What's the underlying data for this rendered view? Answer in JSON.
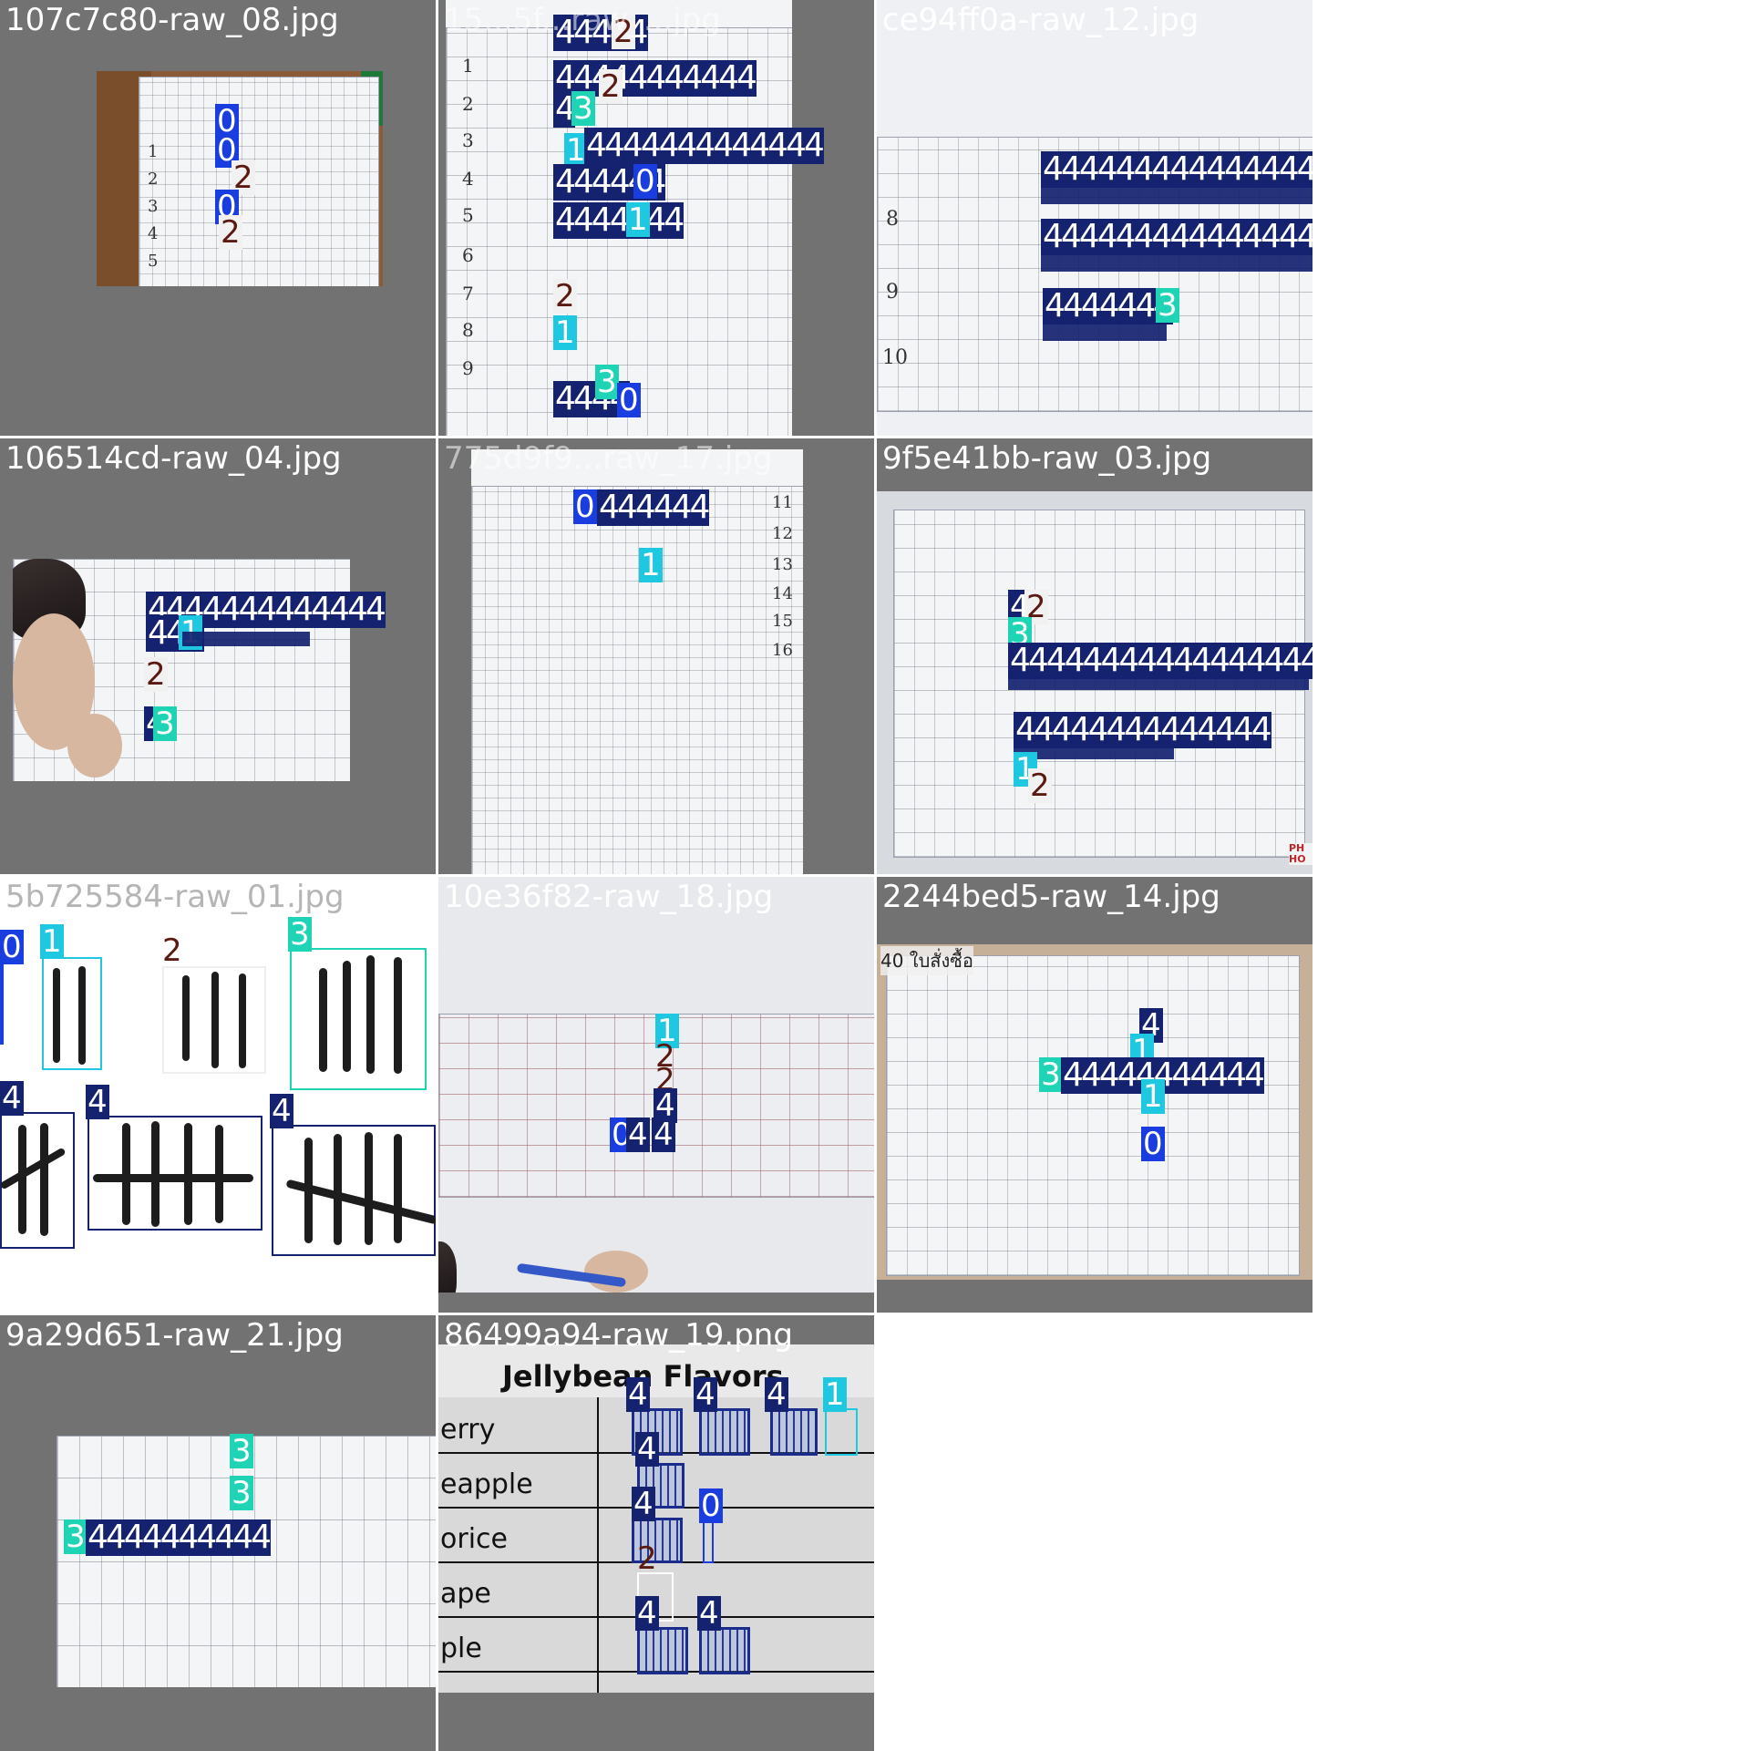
{
  "mosaic": {
    "tiles": [
      {
        "filename": "107c7c80-raw_08.jpg"
      },
      {
        "filename": "15...5f...raw_...jpg"
      },
      {
        "filename": "ce94ff0a-raw_12.jpg"
      },
      {
        "filename": "106514cd-raw_04.jpg"
      },
      {
        "filename": "775d9f9...raw_17.jpg"
      },
      {
        "filename": "9f5e41bb-raw_03.jpg"
      },
      {
        "filename": "5b725584-raw_01.jpg"
      },
      {
        "filename": "10e36f82-raw_18.jpg"
      },
      {
        "filename": "2244bed5-raw_14.jpg"
      },
      {
        "filename": "9a29d651-raw_21.jpg"
      },
      {
        "filename": "86499a94-raw_19.png"
      }
    ]
  },
  "labels": {
    "t1": [
      "0",
      "0",
      "2",
      "0",
      "2"
    ],
    "t1_rows": [
      "1",
      "2",
      "3",
      "4",
      "5"
    ],
    "t2": [
      "2",
      "2",
      "3",
      "1",
      "0",
      "1",
      "2",
      "1",
      "3",
      "0"
    ],
    "t2_rows": [
      "1",
      "2",
      "3",
      "4",
      "5",
      "6",
      "7",
      "8",
      "9"
    ],
    "t2_seq": [
      "44444",
      "44444444444",
      "4",
      "4444444444444",
      "444444",
      "4444444",
      "4444"
    ],
    "t3_rows": [
      "8",
      "9",
      "10"
    ],
    "t3_seq": [
      "4444444444444444444",
      "4444444444444444444",
      "4444444"
    ],
    "t3_label": "3",
    "t4": [
      "4",
      "1",
      "2",
      "3",
      "4"
    ],
    "t4_seq": [
      "4444444444444",
      "444"
    ],
    "t5": [
      "0",
      "1"
    ],
    "t5_seq": "444444",
    "t5_rows": [
      "11",
      "12",
      "13",
      "14",
      "15",
      "16"
    ],
    "t6": [
      "4",
      "2",
      "3",
      "1",
      "2"
    ],
    "t6_seq": [
      "444444444444444444444",
      "44444444444444"
    ],
    "t6_corner": "PH HO",
    "t7": [
      "0",
      "1",
      "2",
      "3",
      "4",
      "4",
      "4"
    ],
    "t8": [
      "1",
      "2",
      "2",
      "4",
      "0",
      "4",
      "4"
    ],
    "t9": [
      "4",
      "1",
      "3",
      "1",
      "0"
    ],
    "t9_seq": "44444444444",
    "t9_tag": "40 ใบสั่งซื้อ",
    "t10": [
      "3",
      "3",
      "3"
    ],
    "t10_seq": "4444444444",
    "t11_title": "Jellybean Flavors",
    "t11_rows": [
      "erry",
      "eapple",
      "orice",
      "ape",
      "ple"
    ],
    "t11": [
      "4",
      "4",
      "4",
      "1",
      "4",
      "4",
      "0",
      "2",
      "4",
      "4"
    ]
  },
  "colors": {
    "class_0": "#1a3de0",
    "class_1": "#1ec8e0",
    "class_2": "#f1f1f1",
    "class_3": "#1fd4b4",
    "class_4": "#142270",
    "tile_bg": "#727272"
  }
}
